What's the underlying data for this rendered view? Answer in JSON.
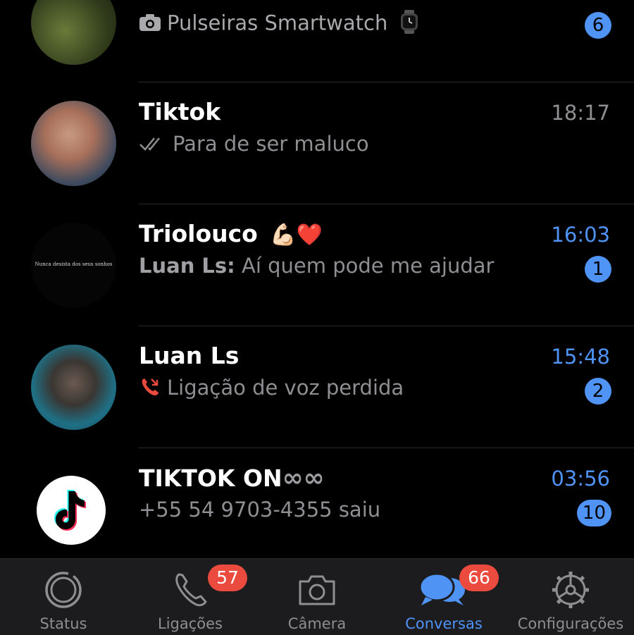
{
  "chats": [
    {
      "name": "",
      "preview_icon": "camera-icon",
      "preview": "Pulseiras Smartwatch",
      "preview_suffix_icon": "watch-icon",
      "time": "",
      "badge": "6"
    },
    {
      "name": "Tiktok",
      "preview_icon": "double-check-icon",
      "preview": "Para de ser maluco",
      "time": "18:17",
      "badge": ""
    },
    {
      "name": "Triolouco",
      "name_emoji": "💪🏻❤️",
      "avatar_caption": "Nunca desista dos seus sonhos",
      "sender": "Luan Ls:",
      "preview": "Aí quem pode me ajudar",
      "time": "16:03",
      "badge": "1"
    },
    {
      "name": "Luan Ls",
      "preview_icon": "missed-call-icon",
      "preview": "Ligação de voz perdida",
      "time": "15:48",
      "badge": "2"
    },
    {
      "name": "TIKTOK ON",
      "name_suffix": "∞∞",
      "preview": "+55 54 9703-4355 saiu",
      "time": "03:56",
      "badge": "10"
    }
  ],
  "tabs": [
    {
      "label": "Status",
      "icon": "status-icon",
      "badge": ""
    },
    {
      "label": "Ligações",
      "icon": "phone-icon",
      "badge": "57"
    },
    {
      "label": "Câmera",
      "icon": "camera-icon",
      "badge": ""
    },
    {
      "label": "Conversas",
      "icon": "chat-bubbles-icon",
      "badge": "66",
      "active": true
    },
    {
      "label": "Configurações",
      "icon": "gear-icon",
      "badge": ""
    }
  ],
  "colors": {
    "accent": "#4f93f5",
    "badge_red": "#eb4b3e",
    "missed_call": "#eb4b3e",
    "background": "#000000",
    "tabbar": "#1c1c1e"
  }
}
